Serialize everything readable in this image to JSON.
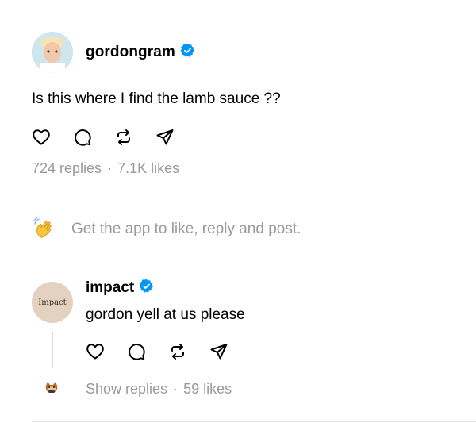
{
  "post": {
    "username": "gordongram",
    "text": "Is this where I find the lamb sauce ??",
    "replies": "724 replies",
    "separator": "·",
    "likes": "7.1K likes"
  },
  "cta": {
    "label": "Get the app to like, reply and post."
  },
  "reply": {
    "username": "impact",
    "avatar_text": "Impact",
    "text": "gordon yell at us please",
    "show_replies": "Show replies",
    "separator": "·",
    "likes": "59 likes"
  },
  "colors": {
    "verified_blue": "#0095f6",
    "muted_text": "#9a9a9a",
    "divider": "#e6e6e6"
  },
  "icons": [
    "heart-icon",
    "comment-icon",
    "repost-icon",
    "share-icon",
    "verified-badge-icon",
    "waving-hand-icon"
  ]
}
